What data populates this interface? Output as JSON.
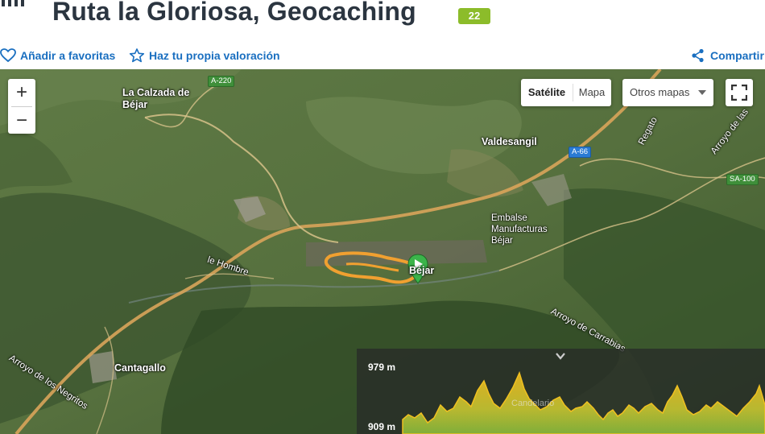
{
  "header": {
    "title": "Ruta la Gloriosa, Geocaching",
    "badge": "22",
    "actions": {
      "favorite": "Añadir a favoritas",
      "rate": "Haz tu propia valoración",
      "share": "Compartir"
    }
  },
  "colors": {
    "link": "#1a6fc0",
    "badge": "#8cbc2a",
    "route": "#f0a030",
    "marker": "#3bb44a"
  },
  "map": {
    "controls": {
      "zoom_in": "+",
      "zoom_out": "−",
      "satellite": "Satélite",
      "map": "Mapa",
      "other_maps": "Otros mapas"
    },
    "labels": {
      "calzada_line1": "La Calzada de",
      "calzada_line2": "Béjar",
      "valdesangil": "Valdesangil",
      "embalse_line1": "Embalse",
      "embalse_line2": "Manufacturas",
      "embalse_line3": "Béjar",
      "bejar": "Béjar",
      "cantagallo": "Cantagallo",
      "arroyo_carrabias": "Arroyo de Carrabias",
      "arroyo_negritos": "Arroyo de los Negritos",
      "hombre": "le Hombre",
      "arroyo_las": "Arroyo de las",
      "regato": "Regato",
      "candelario": "Candelario"
    },
    "roads": {
      "a220": "A-220",
      "a66": "A-66",
      "sa100": "SA-100"
    }
  },
  "profile": {
    "max_label": "979 m",
    "min_label": "909 m",
    "max_m": 979,
    "min_m": 909
  }
}
